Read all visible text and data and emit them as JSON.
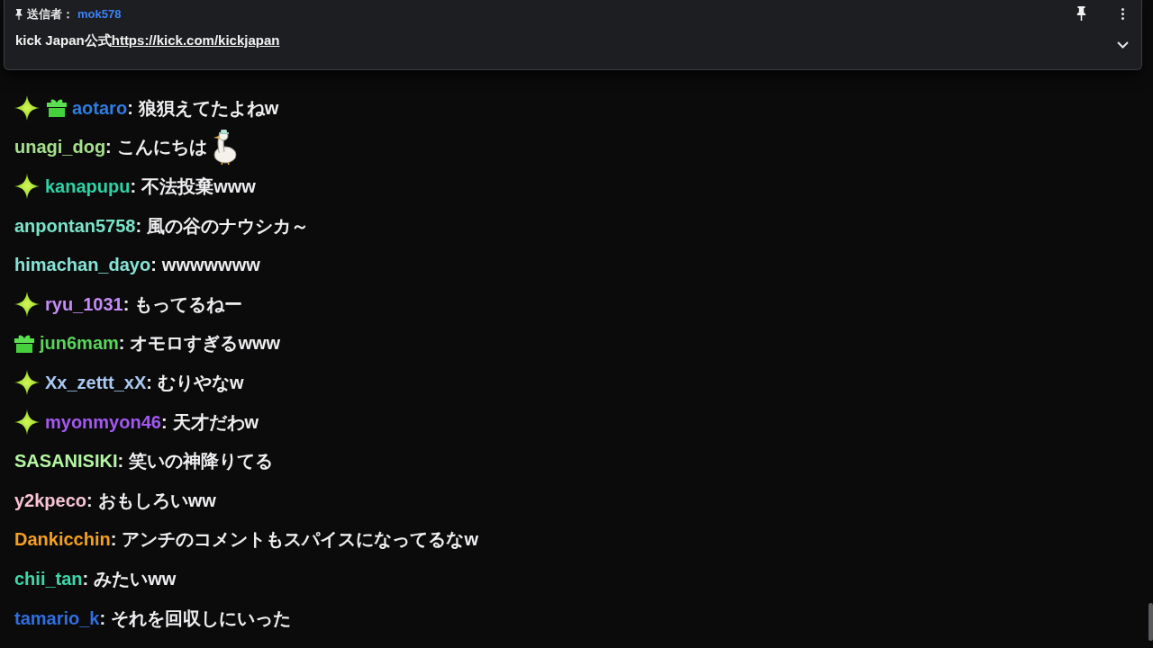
{
  "pinned_message": {
    "label": "送信者：",
    "sender": "mok578",
    "text": "kick Japan公式",
    "link": "https://kick.com/kickjapan"
  },
  "messages": [
    {
      "badges": [
        {
          "kind": "star"
        },
        {
          "kind": "gift"
        }
      ],
      "user": "aotaro",
      "color": "#2f7de1",
      "separator": ":",
      "text": "狼狽えてたよねw"
    },
    {
      "user": "unagi_dog",
      "color": "#a6e08c",
      "separator": ":",
      "text": "こんにちは",
      "emotes": [
        {
          "kind": "duck"
        }
      ]
    },
    {
      "badges": [
        {
          "kind": "star"
        }
      ],
      "user": "kanapupu",
      "color": "#2ed3a5",
      "separator": ":",
      "text": "不法投棄www"
    },
    {
      "user": "anpontan5758",
      "color": "#79e5c9",
      "separator": ":",
      "text": "風の谷のナウシカ～"
    },
    {
      "user": "himachan_dayo",
      "color": "#86e3d4",
      "separator": ":",
      "text": "wwwwwww"
    },
    {
      "badges": [
        {
          "kind": "star"
        }
      ],
      "user": "ryu_1031",
      "color": "#c48cf5",
      "separator": ":",
      "text": "もってるねー"
    },
    {
      "badges": [
        {
          "kind": "gift"
        }
      ],
      "user": "jun6mam",
      "color": "#5ad45a",
      "separator": ":",
      "text": "オモロすぎるwww"
    },
    {
      "badges": [
        {
          "kind": "star"
        }
      ],
      "user": "Xx_zettt_xX",
      "color": "#a9c9f2",
      "separator": ":",
      "text": "むりやなw"
    },
    {
      "badges": [
        {
          "kind": "star"
        }
      ],
      "user": "myonmyon46",
      "color": "#a259f0",
      "separator": ":",
      "text": "天才だわw"
    },
    {
      "user": "SASANISIKI",
      "color": "#b4f7a2",
      "separator": ":",
      "text": "笑いの神降りてる"
    },
    {
      "user": "y2kpeco",
      "color": "#f7c4d4",
      "separator": ":",
      "text": "おもしろいww"
    },
    {
      "user": "Dankicchin",
      "color": "#f5a020",
      "separator": ":",
      "text": "アンチのコメントもスパイスになってるなw"
    },
    {
      "user": "chii_tan",
      "color": "#3dd8a8",
      "separator": ":",
      "text": "みたいww"
    },
    {
      "user": "tamario_k",
      "color": "#2f6fe0",
      "separator": ":",
      "text": "それを回収しにいった"
    }
  ]
}
